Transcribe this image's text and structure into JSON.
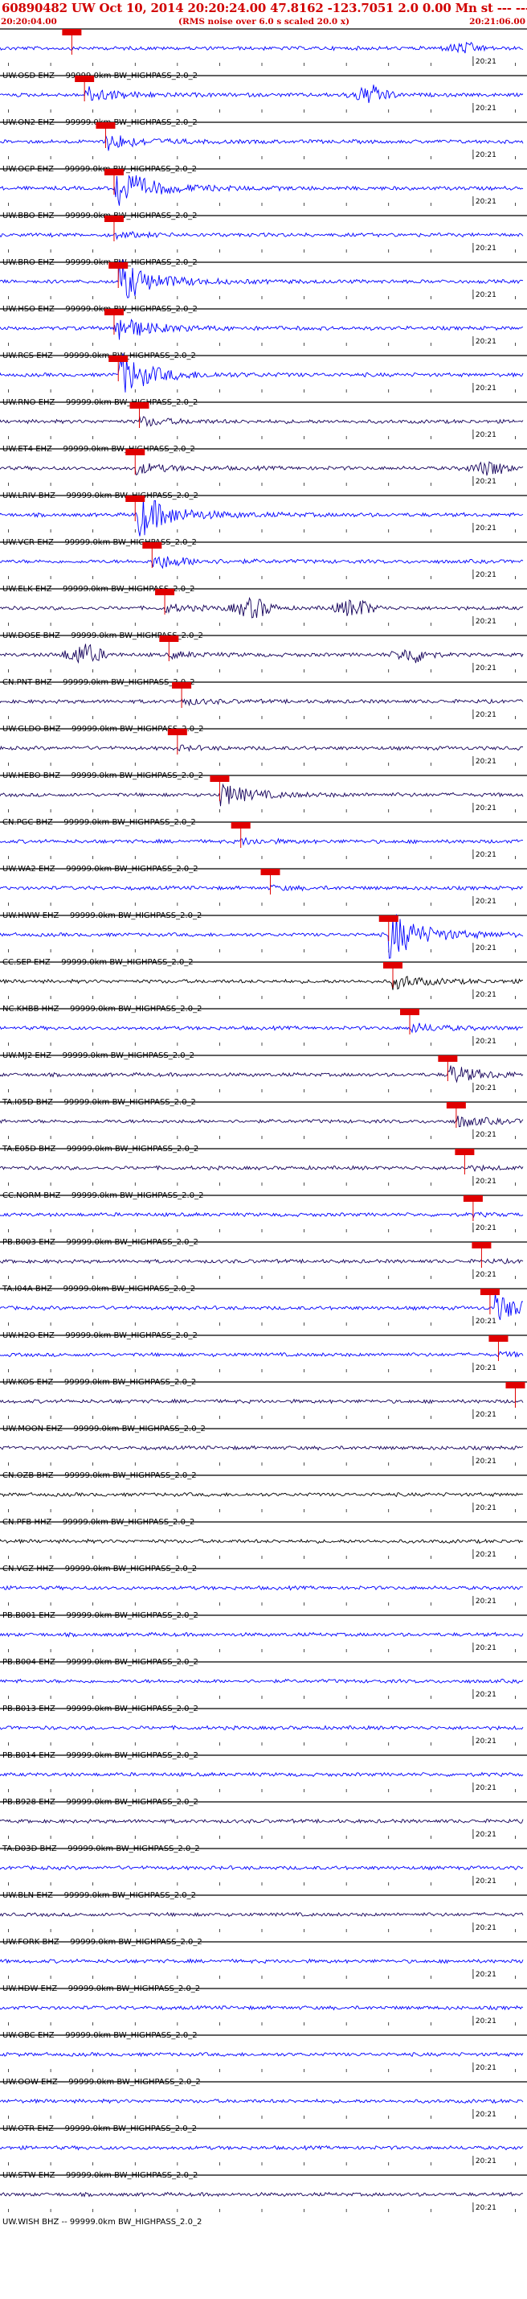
{
  "header": {
    "title": "60890482 UW Oct 10, 2014 20:20:24.00   47.8162 -123.7051  2.0 0.00 Mn st --- --- -1",
    "start_time": "20:20:04.00",
    "scale_note": "(RMS noise over 6.0 s scaled 20.0 x)",
    "end_time": "20:21:06.00"
  },
  "colors": {
    "header_red": "#d00000",
    "blue": "#0000ff",
    "navy": "#14005a",
    "black": "#000000",
    "pick": "#e00000"
  },
  "chart_data": {
    "type": "line",
    "title": "60890482 UW Oct 10, 2014 20:20:24.00   47.8162 -123.7051  2.0 0.00 Mn st --- --- -1",
    "xlabel": "",
    "ylabel": "",
    "time_range": [
      "20:20:04.00",
      "20:21:06.00"
    ],
    "minute_tick_label": "20:21",
    "filter": "BW_HIGHPASS_2.0_2",
    "traces": [
      {
        "label": "UW.OSD EHZ -- 99999.0km BW_HIGHPASS_2.0_2",
        "color": "blue",
        "pick": "20:20:12.5",
        "arrival": "20:20:13",
        "burst": 0.0,
        "late": [
          {
            "t": "20:20:59",
            "a": 0.7
          }
        ]
      },
      {
        "label": "UW.ON2 EHZ -- 99999.0km BW_HIGHPASS_2.0_2",
        "color": "blue",
        "pick": "20:20:14",
        "arrival": "20:20:14",
        "burst": 0.9,
        "late": [
          {
            "t": "20:20:48",
            "a": 1.3
          }
        ]
      },
      {
        "label": "UW.OCP EHZ -- 99999.0km BW_HIGHPASS_2.0_2",
        "color": "blue",
        "pick": "20:20:16.5",
        "arrival": "20:20:16.5",
        "burst": 1.0,
        "late": []
      },
      {
        "label": "UW.BBO EHZ -- 99999.0km BW_HIGHPASS_2.0_2",
        "color": "blue",
        "pick": "20:20:17.5",
        "arrival": "20:20:17.5",
        "burst": 2.6,
        "late": []
      },
      {
        "label": "UW.BRO EHZ -- 99999.0km BW_HIGHPASS_2.0_2",
        "color": "blue",
        "pick": "20:20:17.5",
        "arrival": "20:20:17.5",
        "burst": 0.3,
        "late": []
      },
      {
        "label": "UW.HSO EHZ -- 99999.0km BW_HIGHPASS_2.0_2",
        "color": "blue",
        "pick": "20:20:18",
        "arrival": "20:20:18",
        "burst": 2.5,
        "late": []
      },
      {
        "label": "UW.RCS EHZ -- 99999.0km BW_HIGHPASS_2.0_2",
        "color": "blue",
        "pick": "20:20:17.5",
        "arrival": "20:20:17.5",
        "burst": 1.6,
        "late": []
      },
      {
        "label": "UW.RNO EHZ -- 99999.0km BW_HIGHPASS_2.0_2",
        "color": "blue",
        "pick": "20:20:18",
        "arrival": "20:20:18",
        "burst": 2.5,
        "late": []
      },
      {
        "label": "UW.ET4 EHZ -- 99999.0km BW_HIGHPASS_2.0_2",
        "color": "navy",
        "pick": "20:20:20.5",
        "arrival": "20:20:20.5",
        "burst": 0.5,
        "late": []
      },
      {
        "label": "UW.LRIV BHZ -- 99999.0km BW_HIGHPASS_2.0_2",
        "color": "navy",
        "pick": "20:20:20",
        "arrival": "20:20:20",
        "burst": 0.6,
        "late": [
          {
            "t": "20:21:02",
            "a": 1.0
          }
        ]
      },
      {
        "label": "UW.VCR EHZ -- 99999.0km BW_HIGHPASS_2.0_2",
        "color": "blue",
        "pick": "20:20:20",
        "arrival": "20:20:20",
        "burst": 2.8,
        "late": []
      },
      {
        "label": "UW.ELK EHZ -- 99999.0km BW_HIGHPASS_2.0_2",
        "color": "blue",
        "pick": "20:20:22",
        "arrival": "20:20:22",
        "burst": 0.9,
        "late": []
      },
      {
        "label": "UW.DOSE BHZ -- 99999.0km BW_HIGHPASS_2.0_2",
        "color": "navy",
        "pick": "20:20:23.5",
        "arrival": "20:20:23.5",
        "burst": 0.4,
        "late": [
          {
            "t": "20:20:34",
            "a": 1.4
          },
          {
            "t": "20:20:46",
            "a": 1.3
          }
        ]
      },
      {
        "label": "CN.PNT BHZ -- 99999.0km BW_HIGHPASS_2.0_2",
        "color": "navy",
        "pick": "20:20:24",
        "arrival": "20:20:24",
        "burst": 0.3,
        "late": [
          {
            "t": "20:20:14",
            "a": 1.5
          },
          {
            "t": "20:20:53",
            "a": 1.1
          }
        ]
      },
      {
        "label": "UW.GLDO BHZ -- 99999.0km BW_HIGHPASS_2.0_2",
        "color": "navy",
        "pick": "20:20:25.5",
        "arrival": "20:20:25.5",
        "burst": 0.3,
        "late": []
      },
      {
        "label": "UW.HEBO BHZ -- 99999.0km BW_HIGHPASS_2.0_2",
        "color": "navy",
        "pick": "20:20:25",
        "arrival": "20:20:25",
        "burst": 0.2,
        "late": []
      },
      {
        "label": "CN.PGC BHZ -- 99999.0km BW_HIGHPASS_2.0_2",
        "color": "navy",
        "pick": "20:20:30",
        "arrival": "20:20:30",
        "burst": 1.3,
        "late": []
      },
      {
        "label": "UW.WA2 EHZ -- 99999.0km BW_HIGHPASS_2.0_2",
        "color": "blue",
        "pick": "20:20:32.5",
        "arrival": "20:20:32.5",
        "burst": 0.3,
        "late": []
      },
      {
        "label": "UW.HWW EHZ -- 99999.0km BW_HIGHPASS_2.0_2",
        "color": "blue",
        "pick": "20:20:36",
        "arrival": "20:20:36",
        "burst": 0.2,
        "late": []
      },
      {
        "label": "CC.SEP EHZ -- 99999.0km BW_HIGHPASS_2.0_2",
        "color": "blue",
        "pick": "20:20:50",
        "arrival": "20:20:50",
        "burst": 2.8,
        "late": []
      },
      {
        "label": "NC.KHBB HHZ -- 99999.0km BW_HIGHPASS_2.0_2",
        "color": "black",
        "pick": "20:20:50.5",
        "arrival": "20:20:50.5",
        "burst": 0.8,
        "late": []
      },
      {
        "label": "UW.MJ2 EHZ -- 99999.0km BW_HIGHPASS_2.0_2",
        "color": "blue",
        "pick": "20:20:52.5",
        "arrival": "20:20:52.5",
        "burst": 0.5,
        "late": []
      },
      {
        "label": "TA.I05D BHZ -- 99999.0km BW_HIGHPASS_2.0_2",
        "color": "navy",
        "pick": "20:20:57",
        "arrival": "20:20:57",
        "burst": 1.1,
        "late": []
      },
      {
        "label": "TA.E05D BHZ -- 99999.0km BW_HIGHPASS_2.0_2",
        "color": "navy",
        "pick": "20:20:58",
        "arrival": "20:20:58",
        "burst": 0.6,
        "late": []
      },
      {
        "label": "CC.NORM BHZ -- 99999.0km BW_HIGHPASS_2.0_2",
        "color": "navy",
        "pick": "20:20:59",
        "arrival": "20:20:59",
        "burst": 0.2,
        "late": []
      },
      {
        "label": "PB.B003 EHZ -- 99999.0km BW_HIGHPASS_2.0_2",
        "color": "blue",
        "pick": "20:21:00",
        "arrival": "20:21:00",
        "burst": 0.1,
        "late": []
      },
      {
        "label": "TA.I04A BHZ -- 99999.0km BW_HIGHPASS_2.0_2",
        "color": "navy",
        "pick": "20:21:01",
        "arrival": "20:21:01",
        "burst": 0.1,
        "late": []
      },
      {
        "label": "UW.H2O EHZ -- 99999.0km BW_HIGHPASS_2.0_2",
        "color": "blue",
        "pick": "20:21:02",
        "arrival": "20:21:02.5",
        "burst": 1.5,
        "late": []
      },
      {
        "label": "UW.KOS EHZ -- 99999.0km BW_HIGHPASS_2.0_2",
        "color": "blue",
        "pick": "20:21:03",
        "arrival": "20:21:03",
        "burst": 0.2,
        "late": []
      },
      {
        "label": "UW.MOON EHZ -- 99999.0km BW_HIGHPASS_2.0_2",
        "color": "navy",
        "pick": "20:21:05",
        "arrival": "",
        "burst": 0.0,
        "late": []
      },
      {
        "label": "CN.OZB BHZ -- 99999.0km BW_HIGHPASS_2.0_2",
        "color": "navy",
        "pick": "",
        "arrival": "",
        "burst": 0.0,
        "late": []
      },
      {
        "label": "CN.PFB HHZ -- 99999.0km BW_HIGHPASS_2.0_2",
        "color": "black",
        "pick": "",
        "arrival": "",
        "burst": 0.0,
        "late": []
      },
      {
        "label": "CN.VGZ HHZ -- 99999.0km BW_HIGHPASS_2.0_2",
        "color": "black",
        "pick": "",
        "arrival": "",
        "burst": 0.0,
        "late": []
      },
      {
        "label": "PB.B001 EHZ -- 99999.0km BW_HIGHPASS_2.0_2",
        "color": "blue",
        "pick": "",
        "arrival": "",
        "burst": 0.0,
        "late": []
      },
      {
        "label": "PB.B004 EHZ -- 99999.0km BW_HIGHPASS_2.0_2",
        "color": "blue",
        "pick": "",
        "arrival": "",
        "burst": 0.0,
        "late": []
      },
      {
        "label": "PB.B013 EHZ -- 99999.0km BW_HIGHPASS_2.0_2",
        "color": "blue",
        "pick": "",
        "arrival": "",
        "burst": 0.0,
        "late": []
      },
      {
        "label": "PB.B014 EHZ -- 99999.0km BW_HIGHPASS_2.0_2",
        "color": "blue",
        "pick": "",
        "arrival": "",
        "burst": 0.0,
        "late": []
      },
      {
        "label": "PB.B928 EHZ -- 99999.0km BW_HIGHPASS_2.0_2",
        "color": "blue",
        "pick": "",
        "arrival": "",
        "burst": 0.0,
        "late": []
      },
      {
        "label": "TA.D03D BHZ -- 99999.0km BW_HIGHPASS_2.0_2",
        "color": "navy",
        "pick": "",
        "arrival": "",
        "burst": 0.0,
        "late": []
      },
      {
        "label": "UW.BLN EHZ -- 99999.0km BW_HIGHPASS_2.0_2",
        "color": "blue",
        "pick": "",
        "arrival": "",
        "burst": 0.0,
        "late": []
      },
      {
        "label": "UW.FORK BHZ -- 99999.0km BW_HIGHPASS_2.0_2",
        "color": "navy",
        "pick": "",
        "arrival": "",
        "burst": 0.0,
        "late": []
      },
      {
        "label": "UW.HDW EHZ -- 99999.0km BW_HIGHPASS_2.0_2",
        "color": "blue",
        "pick": "",
        "arrival": "",
        "burst": 0.0,
        "late": []
      },
      {
        "label": "UW.OBC EHZ -- 99999.0km BW_HIGHPASS_2.0_2",
        "color": "blue",
        "pick": "",
        "arrival": "",
        "burst": 0.0,
        "late": []
      },
      {
        "label": "UW.OOW EHZ -- 99999.0km BW_HIGHPASS_2.0_2",
        "color": "blue",
        "pick": "",
        "arrival": "",
        "burst": 0.0,
        "late": []
      },
      {
        "label": "UW.OTR EHZ -- 99999.0km BW_HIGHPASS_2.0_2",
        "color": "blue",
        "pick": "",
        "arrival": "",
        "burst": 0.0,
        "late": []
      },
      {
        "label": "UW.STW EHZ -- 99999.0km BW_HIGHPASS_2.0_2",
        "color": "blue",
        "pick": "",
        "arrival": "",
        "burst": 0.0,
        "late": []
      },
      {
        "label": "UW.WISH BHZ -- 99999.0km BW_HIGHPASS_2.0_2",
        "color": "navy",
        "pick": "",
        "arrival": "",
        "burst": 0.0,
        "late": []
      }
    ]
  }
}
